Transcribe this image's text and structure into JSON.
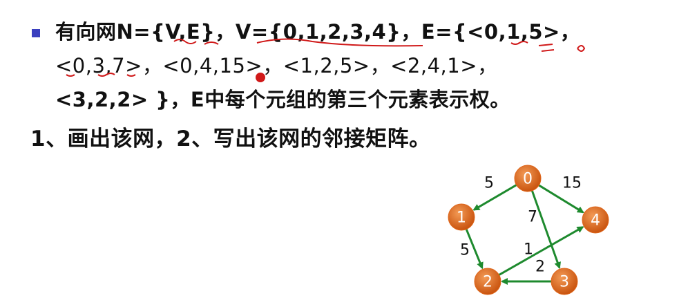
{
  "problem": {
    "line1": "有向网N={V,E}，V={0,1,2,3,4}，E={<0,1,5>，",
    "line2": "<0,3,7>，<0,4,15>，<1,2,5>，<2,4,1>，",
    "line3": "<3,2,2> }，E中每个元组的第三个元素表示权。"
  },
  "task": "1、画出该网，2、写出该网的邻接矩阵。",
  "graph": {
    "node_color": "#e0661a",
    "edge_color": "#1e8a2e",
    "nodes": [
      {
        "id": "0",
        "label": "0"
      },
      {
        "id": "1",
        "label": "1"
      },
      {
        "id": "2",
        "label": "2"
      },
      {
        "id": "3",
        "label": "3"
      },
      {
        "id": "4",
        "label": "4"
      }
    ],
    "edges": [
      {
        "from": "0",
        "to": "1",
        "weight": "5"
      },
      {
        "from": "0",
        "to": "3",
        "weight": "7"
      },
      {
        "from": "0",
        "to": "4",
        "weight": "15"
      },
      {
        "from": "1",
        "to": "2",
        "weight": "5"
      },
      {
        "from": "2",
        "to": "4",
        "weight": "1"
      },
      {
        "from": "3",
        "to": "2",
        "weight": "2"
      }
    ]
  }
}
